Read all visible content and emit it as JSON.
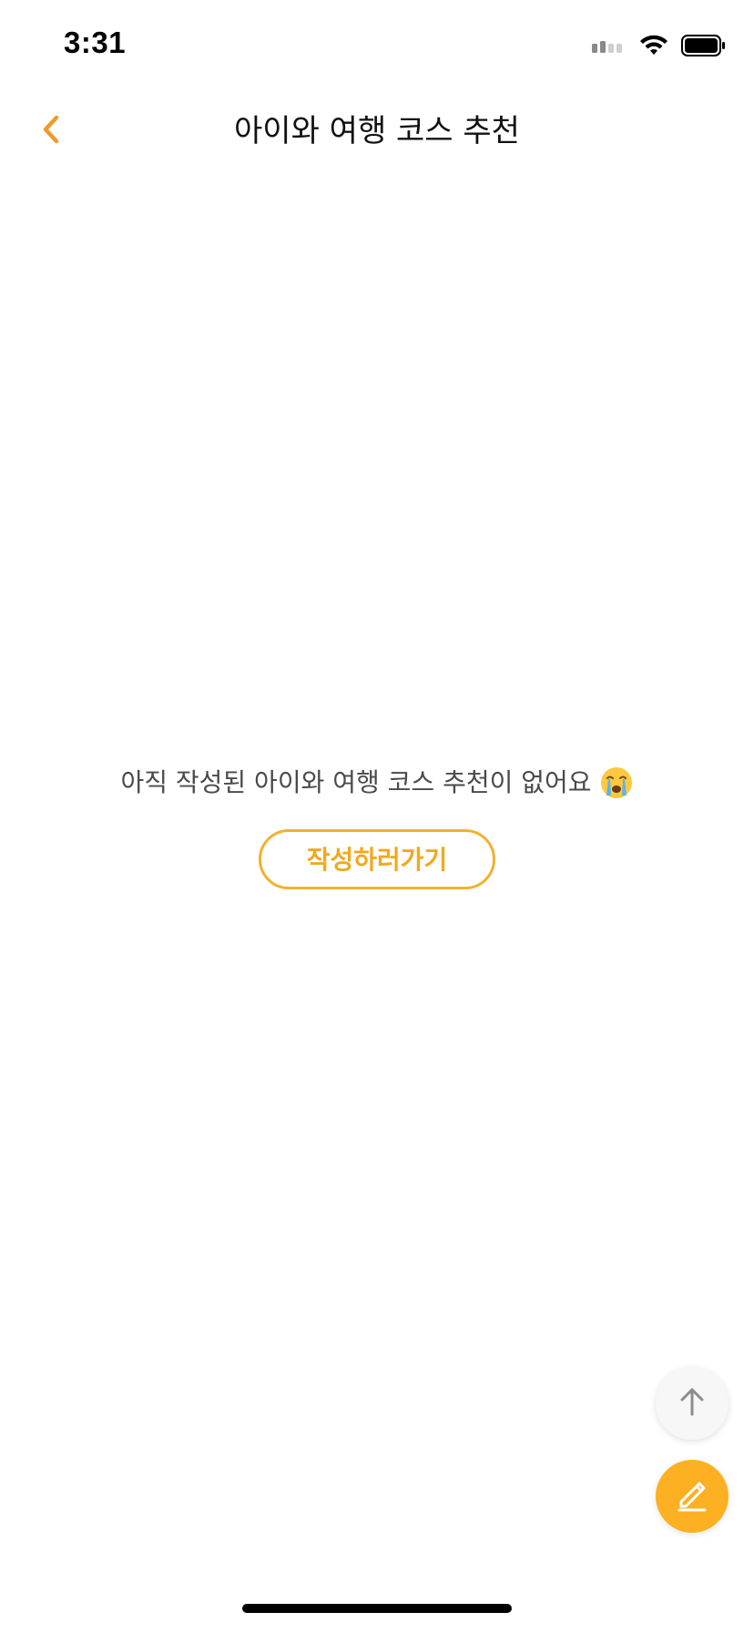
{
  "status_bar": {
    "time": "3:31",
    "signal_icon": "cellular-signal-icon",
    "wifi_icon": "wifi-icon",
    "battery_icon": "battery-icon"
  },
  "nav": {
    "back_icon": "chevron-left-icon",
    "title": "아이와 여행 코스 추천"
  },
  "empty_state": {
    "message": "아직 작성된 아이와 여행 코스 추천이 없어요",
    "emoji_icon": "crying-face-icon",
    "write_button_label": "작성하러가기"
  },
  "floating_buttons": {
    "scroll_top_icon": "arrow-up-icon",
    "write_icon": "pencil-icon"
  },
  "colors": {
    "accent": "#F2B12F",
    "fab_accent": "#FDB022",
    "back_chevron": "#F09A2B",
    "message_text": "#4a4a4a"
  }
}
